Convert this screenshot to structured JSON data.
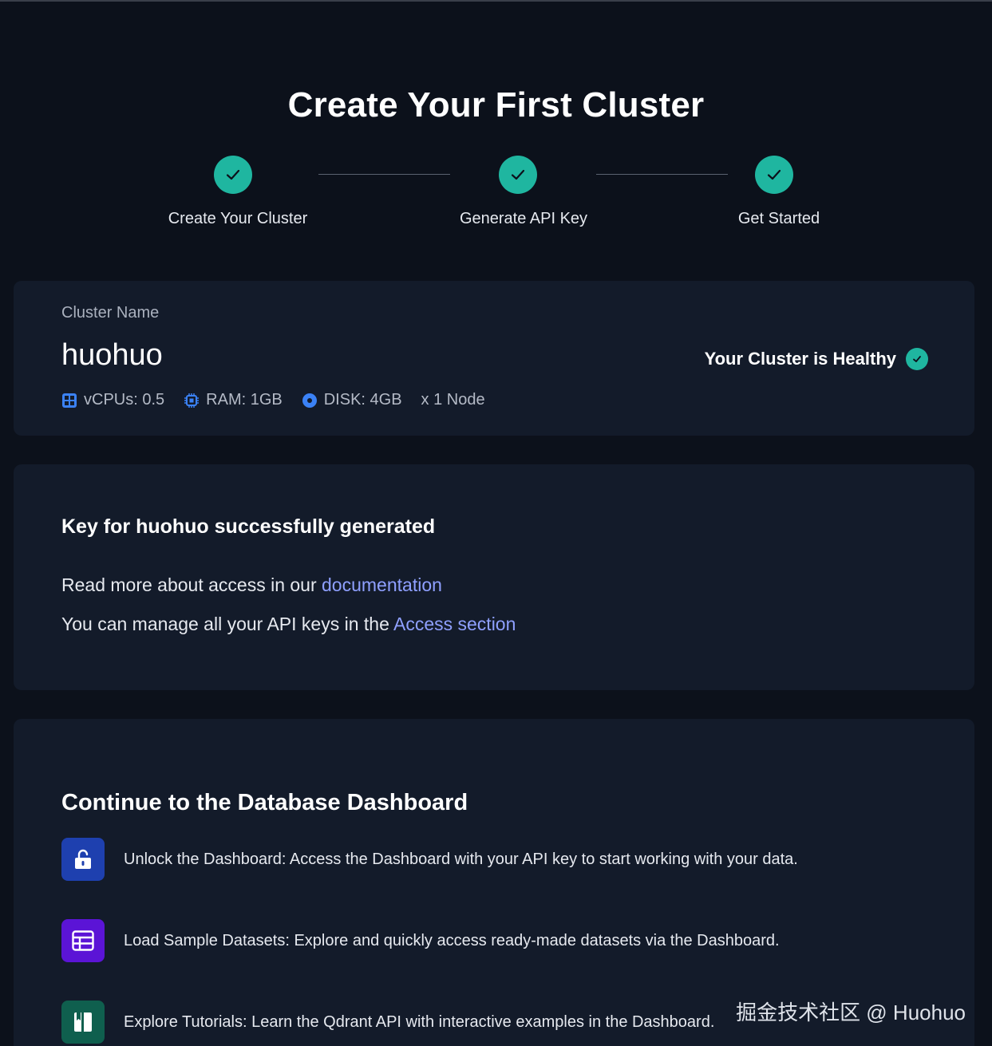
{
  "title": "Create Your First Cluster",
  "steps": [
    {
      "label": "Create Your Cluster",
      "status": "completed"
    },
    {
      "label": "Generate API Key",
      "status": "completed"
    },
    {
      "label": "Get Started",
      "status": "completed"
    }
  ],
  "cluster": {
    "label": "Cluster Name",
    "name": "huohuo",
    "health": "Your Cluster is Healthy",
    "specs": {
      "vcpu": "vCPUs: 0.5",
      "ram": "RAM: 1GB",
      "disk": "DISK: 4GB",
      "nodes": "x 1 Node"
    }
  },
  "key": {
    "title": "Key for huohuo successfully generated",
    "line1_prefix": "Read more about access in our ",
    "line1_link": "documentation",
    "line2_prefix": "You can manage all your API keys in the ",
    "line2_link": "Access section"
  },
  "dashboard": {
    "title": "Continue to the Database Dashboard",
    "features": [
      {
        "icon": "unlock-icon",
        "color": "#1e40af",
        "text": "Unlock the Dashboard: Access the Dashboard with your API key to start working with your data."
      },
      {
        "icon": "table-icon",
        "color": "#5b14d6",
        "text": "Load Sample Datasets: Explore and quickly access ready-made datasets via the Dashboard."
      },
      {
        "icon": "book-icon",
        "color": "#0f5f4e",
        "text": "Explore Tutorials: Learn the Qdrant API with interactive examples in the Dashboard."
      }
    ]
  },
  "watermark": "掘金技术社区 @ Huohuo",
  "colors": {
    "accent": "#1fb6a0",
    "link": "#8fa0ff",
    "background": "#0c111b",
    "card": "#131b2a"
  }
}
